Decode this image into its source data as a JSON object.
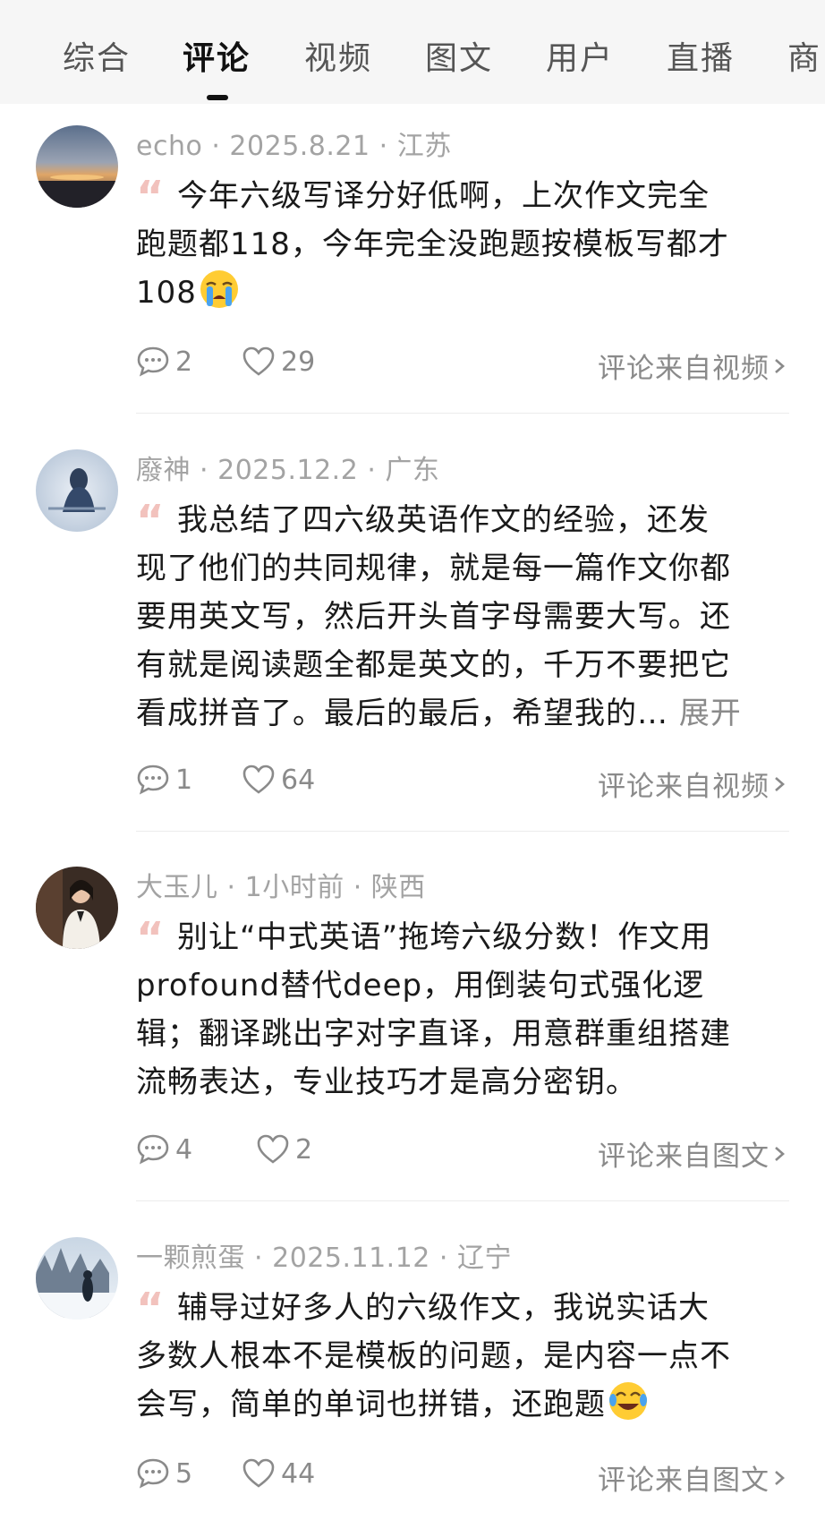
{
  "tabs": [
    {
      "label": "综合",
      "active": false
    },
    {
      "label": "评论",
      "active": true
    },
    {
      "label": "视频",
      "active": false
    },
    {
      "label": "图文",
      "active": false
    },
    {
      "label": "用户",
      "active": false
    },
    {
      "label": "直播",
      "active": false
    },
    {
      "label": "商",
      "active": false
    }
  ],
  "comments": [
    {
      "user": "echo",
      "date": "2025.8.21",
      "location": "江苏",
      "meta": "echo · 2025.8.21 · 江苏",
      "text_lines": [
        "今年六级写译分好低啊，上次作文完全",
        "跑题都118，今年完全没跑题按模板写都才",
        "108"
      ],
      "emoji": "loudly-crying-face",
      "replies": "2",
      "likes": "29",
      "source": "评论来自视频"
    },
    {
      "user": "廢神",
      "date": "2025.12.2",
      "location": "广东",
      "meta": "廢神 · 2025.12.2 · 广东",
      "text_lines": [
        "我总结了四六级英语作文的经验，还发",
        "现了他们的共同规律，就是每一篇作文你都",
        "要用英文写，然后开头首字母需要大写。还",
        "有就是阅读题全都是英文的，千万不要把它",
        "看成拼音了。最后的最后，希望我的…"
      ],
      "expand": "展开",
      "replies": "1",
      "likes": "64",
      "source": "评论来自视频"
    },
    {
      "user": "大玉儿",
      "date": "1小时前",
      "location": "陕西",
      "meta": "大玉儿 · 1小时前 · 陕西",
      "text_lines": [
        "别让“中式英语”拖垮六级分数！作文用",
        "profound替代deep，用倒装句式强化逻",
        "辑；翻译跳出字对字直译，用意群重组搭建",
        "流畅表达，专业技巧才是高分密钥。"
      ],
      "replies": "4",
      "likes": "2",
      "source": "评论来自图文"
    },
    {
      "user": "一颗煎蛋",
      "date": "2025.11.12",
      "location": "辽宁",
      "meta": "一颗煎蛋 · 2025.11.12 · 辽宁",
      "text_lines": [
        "辅导过好多人的六级作文，我说实话大",
        "多数人根本不是模板的问题，是内容一点不",
        "会写，简单的单词也拼错，还跑题"
      ],
      "emoji": "face-with-tears-of-joy",
      "replies": "5",
      "likes": "44",
      "source": "评论来自图文"
    }
  ],
  "colors": {
    "tab_bar_bg": "#f6f6f6",
    "meta_text": "#a3a3a3",
    "quote_mark": "#f2c2bd",
    "secondary_text": "#8a8a8a"
  }
}
